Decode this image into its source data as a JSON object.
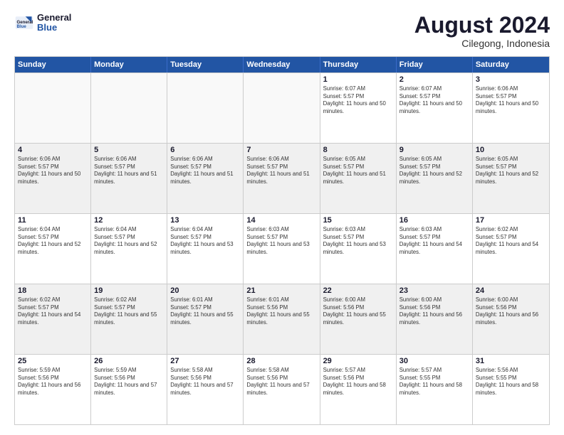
{
  "header": {
    "logo": {
      "general": "General",
      "blue": "Blue"
    },
    "month_year": "August 2024",
    "location": "Cilegong, Indonesia"
  },
  "weekdays": [
    "Sunday",
    "Monday",
    "Tuesday",
    "Wednesday",
    "Thursday",
    "Friday",
    "Saturday"
  ],
  "rows": [
    [
      {
        "day": "",
        "empty": true
      },
      {
        "day": "",
        "empty": true
      },
      {
        "day": "",
        "empty": true
      },
      {
        "day": "",
        "empty": true
      },
      {
        "day": "1",
        "sunrise": "6:07 AM",
        "sunset": "5:57 PM",
        "daylight": "11 hours and 50 minutes."
      },
      {
        "day": "2",
        "sunrise": "6:07 AM",
        "sunset": "5:57 PM",
        "daylight": "11 hours and 50 minutes."
      },
      {
        "day": "3",
        "sunrise": "6:06 AM",
        "sunset": "5:57 PM",
        "daylight": "11 hours and 50 minutes."
      }
    ],
    [
      {
        "day": "4",
        "sunrise": "6:06 AM",
        "sunset": "5:57 PM",
        "daylight": "11 hours and 50 minutes."
      },
      {
        "day": "5",
        "sunrise": "6:06 AM",
        "sunset": "5:57 PM",
        "daylight": "11 hours and 51 minutes."
      },
      {
        "day": "6",
        "sunrise": "6:06 AM",
        "sunset": "5:57 PM",
        "daylight": "11 hours and 51 minutes."
      },
      {
        "day": "7",
        "sunrise": "6:06 AM",
        "sunset": "5:57 PM",
        "daylight": "11 hours and 51 minutes."
      },
      {
        "day": "8",
        "sunrise": "6:05 AM",
        "sunset": "5:57 PM",
        "daylight": "11 hours and 51 minutes."
      },
      {
        "day": "9",
        "sunrise": "6:05 AM",
        "sunset": "5:57 PM",
        "daylight": "11 hours and 52 minutes."
      },
      {
        "day": "10",
        "sunrise": "6:05 AM",
        "sunset": "5:57 PM",
        "daylight": "11 hours and 52 minutes."
      }
    ],
    [
      {
        "day": "11",
        "sunrise": "6:04 AM",
        "sunset": "5:57 PM",
        "daylight": "11 hours and 52 minutes."
      },
      {
        "day": "12",
        "sunrise": "6:04 AM",
        "sunset": "5:57 PM",
        "daylight": "11 hours and 52 minutes."
      },
      {
        "day": "13",
        "sunrise": "6:04 AM",
        "sunset": "5:57 PM",
        "daylight": "11 hours and 53 minutes."
      },
      {
        "day": "14",
        "sunrise": "6:03 AM",
        "sunset": "5:57 PM",
        "daylight": "11 hours and 53 minutes."
      },
      {
        "day": "15",
        "sunrise": "6:03 AM",
        "sunset": "5:57 PM",
        "daylight": "11 hours and 53 minutes."
      },
      {
        "day": "16",
        "sunrise": "6:03 AM",
        "sunset": "5:57 PM",
        "daylight": "11 hours and 54 minutes."
      },
      {
        "day": "17",
        "sunrise": "6:02 AM",
        "sunset": "5:57 PM",
        "daylight": "11 hours and 54 minutes."
      }
    ],
    [
      {
        "day": "18",
        "sunrise": "6:02 AM",
        "sunset": "5:57 PM",
        "daylight": "11 hours and 54 minutes."
      },
      {
        "day": "19",
        "sunrise": "6:02 AM",
        "sunset": "5:57 PM",
        "daylight": "11 hours and 55 minutes."
      },
      {
        "day": "20",
        "sunrise": "6:01 AM",
        "sunset": "5:57 PM",
        "daylight": "11 hours and 55 minutes."
      },
      {
        "day": "21",
        "sunrise": "6:01 AM",
        "sunset": "5:56 PM",
        "daylight": "11 hours and 55 minutes."
      },
      {
        "day": "22",
        "sunrise": "6:00 AM",
        "sunset": "5:56 PM",
        "daylight": "11 hours and 55 minutes."
      },
      {
        "day": "23",
        "sunrise": "6:00 AM",
        "sunset": "5:56 PM",
        "daylight": "11 hours and 56 minutes."
      },
      {
        "day": "24",
        "sunrise": "6:00 AM",
        "sunset": "5:56 PM",
        "daylight": "11 hours and 56 minutes."
      }
    ],
    [
      {
        "day": "25",
        "sunrise": "5:59 AM",
        "sunset": "5:56 PM",
        "daylight": "11 hours and 56 minutes."
      },
      {
        "day": "26",
        "sunrise": "5:59 AM",
        "sunset": "5:56 PM",
        "daylight": "11 hours and 57 minutes."
      },
      {
        "day": "27",
        "sunrise": "5:58 AM",
        "sunset": "5:56 PM",
        "daylight": "11 hours and 57 minutes."
      },
      {
        "day": "28",
        "sunrise": "5:58 AM",
        "sunset": "5:56 PM",
        "daylight": "11 hours and 57 minutes."
      },
      {
        "day": "29",
        "sunrise": "5:57 AM",
        "sunset": "5:56 PM",
        "daylight": "11 hours and 58 minutes."
      },
      {
        "day": "30",
        "sunrise": "5:57 AM",
        "sunset": "5:55 PM",
        "daylight": "11 hours and 58 minutes."
      },
      {
        "day": "31",
        "sunrise": "5:56 AM",
        "sunset": "5:55 PM",
        "daylight": "11 hours and 58 minutes."
      }
    ]
  ]
}
